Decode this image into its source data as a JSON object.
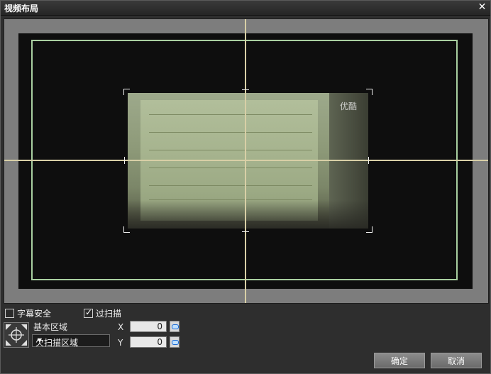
{
  "window": {
    "title": "视频布局",
    "close_glyph": "✕"
  },
  "preview": {
    "watermark": "优酷"
  },
  "options": {
    "subtitle_safe": {
      "label": "字幕安全",
      "checked": false
    },
    "overscan": {
      "label": "过扫描",
      "checked": true
    }
  },
  "position": {
    "base_area_label": "基本区域",
    "area_select_value": "欠扫描区域",
    "x_label": "X",
    "x_value": "0",
    "y_label": "Y",
    "y_value": "0"
  },
  "buttons": {
    "ok": "确定",
    "cancel": "取消"
  },
  "colors": {
    "guide_line": "#d8cfa6",
    "safe_rect": "#a9cfa0"
  }
}
